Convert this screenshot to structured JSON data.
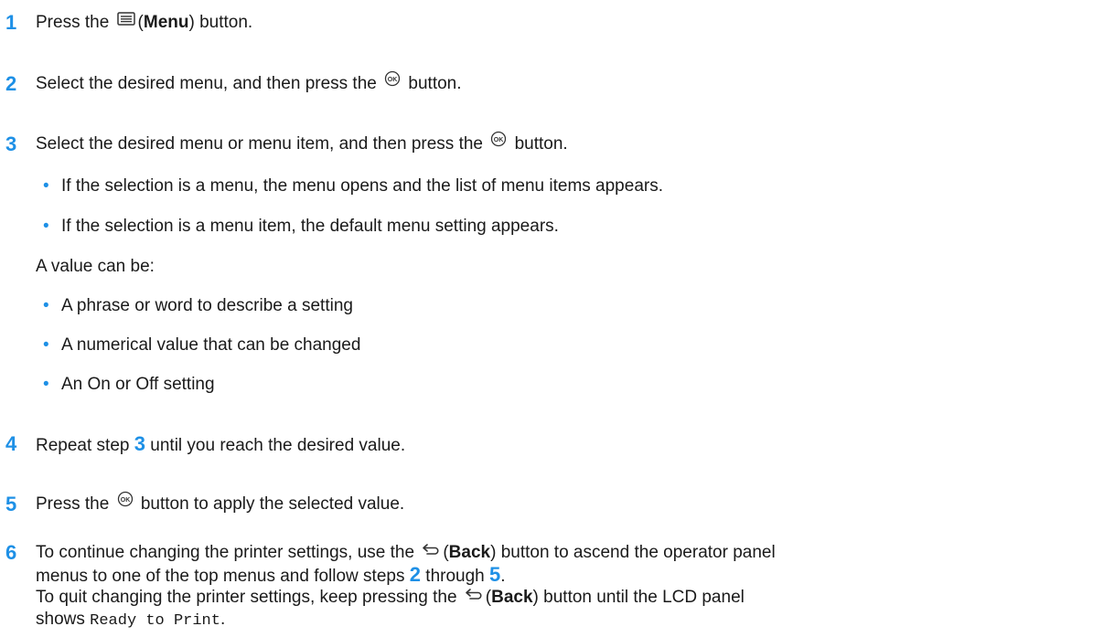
{
  "steps": [
    {
      "number": "1",
      "pre": "Press the",
      "label": "Menu",
      "post": ") button."
    },
    {
      "number": "2",
      "pre": "Select the desired menu, and then press the",
      "post": "button."
    },
    {
      "number": "3",
      "pre": "Select the desired menu or menu item, and then press the",
      "post": "button.",
      "bullets": [
        "If the selection is a menu, the menu opens and the list of menu items appears.",
        "If the selection is a menu item, the default menu setting appears."
      ],
      "value_intro": "A value can be:",
      "value_bullets": [
        "A phrase or word to describe a setting",
        "A numerical value that can be changed",
        "An On or Off setting"
      ]
    },
    {
      "number": "4",
      "pre": "Repeat step",
      "ref": "3",
      "post": "until you reach the desired value."
    },
    {
      "number": "5",
      "pre": "Press the",
      "post": "button to apply the selected value."
    },
    {
      "number": "6",
      "line1_pre": "To continue changing the printer settings, use the",
      "line1_label": "Back",
      "line1_post": ") button to ascend the operator panel",
      "line2_pre": "menus to one of the top menus and follow steps",
      "line2_ref1": "2",
      "line2_mid": "through",
      "line2_ref2": "5",
      "line2_end": ".",
      "para_pre": "To quit changing the printer settings, keep pressing the",
      "para_label": "Back",
      "para_post": ") button until the LCD panel",
      "para_line2_pre": "shows",
      "para_code": "Ready to Print",
      "para_end": "."
    }
  ],
  "icons": {
    "menu": "menu-icon",
    "ok": "ok-button-icon",
    "back": "back-arrow-icon"
  }
}
